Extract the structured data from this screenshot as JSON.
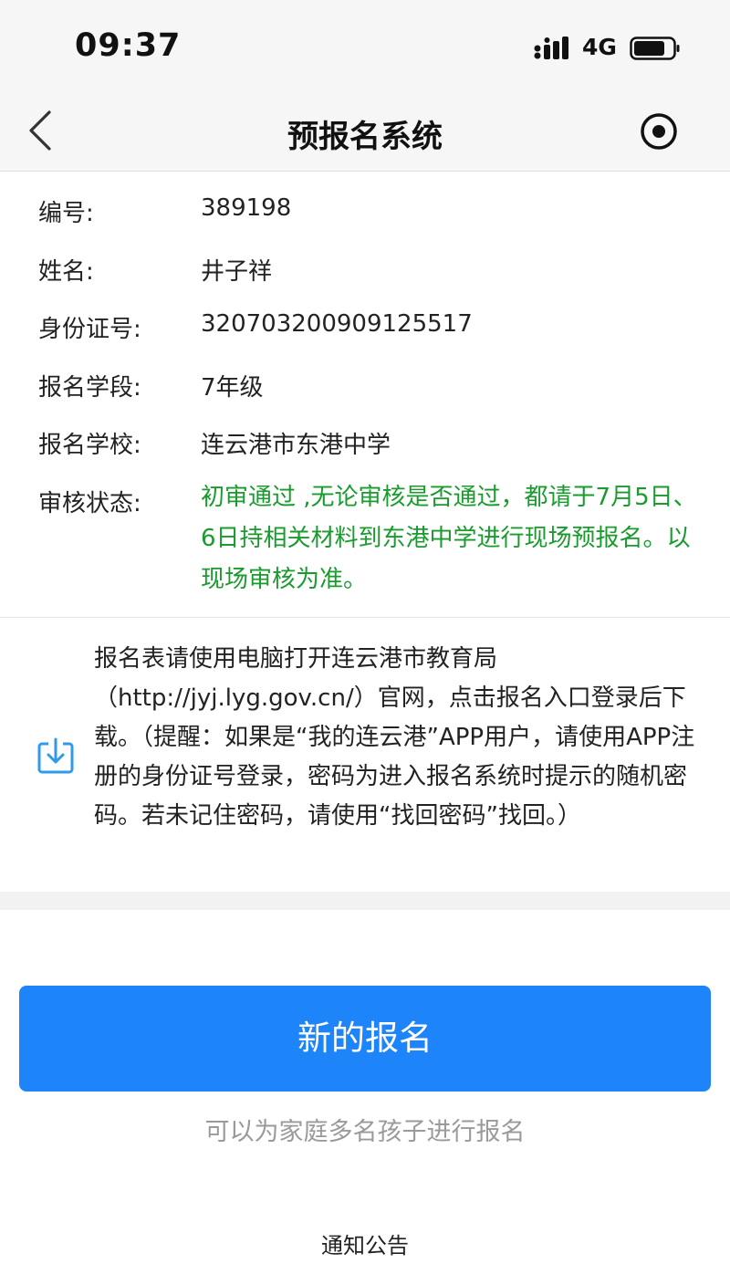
{
  "status_bar": {
    "time": "09:37",
    "network": "4G"
  },
  "nav": {
    "title": "预报名系统"
  },
  "info": {
    "id_label": "编号:",
    "id_value": "389198",
    "name_label": "姓名:",
    "name_value": "井子祥",
    "idcard_label": "身份证号:",
    "idcard_value": "320703200909125517",
    "grade_label": "报名学段:",
    "grade_value": "7年级",
    "school_label": "报名学校:",
    "school_value": "连云港市东港中学",
    "review_label": "审核状态:",
    "review_value": "初审通过 ,无论审核是否通过，都请于7月5日、6日持相关材料到东港中学进行现场预报名。以现场审核为准。"
  },
  "notice": {
    "text": "报名表请使用电脑打开连云港市教育局（http://jyj.lyg.gov.cn/）官网，点击报名入口登录后下载。（提醒：如果是“我的连云港”APP用户，请使用APP注册的身份证号登录，密码为进入报名系统时提示的随机密码。若未记住密码，请使用“找回密码”找回。）"
  },
  "actions": {
    "new_registration": "新的报名",
    "hint": "可以为家庭多名孩子进行报名",
    "footer": "通知公告"
  },
  "colors": {
    "primary": "#1d85f9",
    "status_green": "#1a9b2e",
    "icon_blue": "#2f9be8"
  }
}
